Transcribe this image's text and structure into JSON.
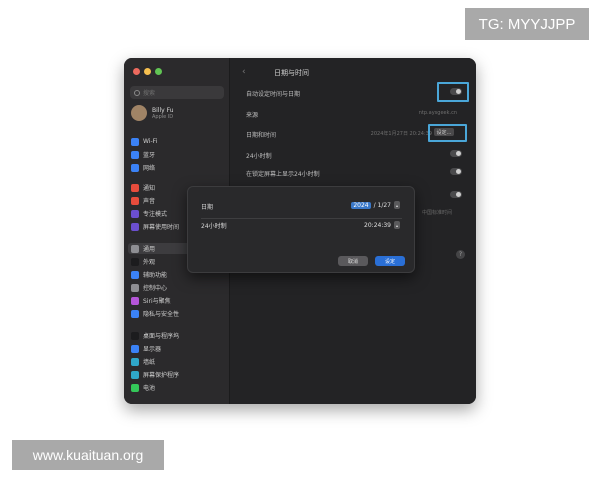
{
  "overlay": {
    "tg_label": "TG: MYYJJPP",
    "watermark": "www.kuaituan.org"
  },
  "window": {
    "title": "日期与时间",
    "search_placeholder": "搜索",
    "user": {
      "name": "Billy Fu",
      "subtitle": "Apple ID"
    },
    "sidebar": [
      {
        "label": "Wi-Fi",
        "icon": "wifi-icon",
        "color": "#3b82f6"
      },
      {
        "label": "蓝牙",
        "icon": "bluetooth-icon",
        "color": "#3b82f6"
      },
      {
        "label": "网络",
        "icon": "globe-icon",
        "color": "#3b82f6"
      },
      {
        "label": "通知",
        "icon": "bell-icon",
        "color": "#e74c3c"
      },
      {
        "label": "声音",
        "icon": "speaker-icon",
        "color": "#e74c3c"
      },
      {
        "label": "专注模式",
        "icon": "moon-icon",
        "color": "#6b4fcf"
      },
      {
        "label": "屏幕使用时间",
        "icon": "hourglass-icon",
        "color": "#6b4fcf"
      },
      {
        "label": "通用",
        "icon": "gear-icon",
        "color": "#8e8e93",
        "selected": true
      },
      {
        "label": "外观",
        "icon": "appearance-icon",
        "color": "#1c1c1e"
      },
      {
        "label": "辅助功能",
        "icon": "accessibility-icon",
        "color": "#3b82f6"
      },
      {
        "label": "控制中心",
        "icon": "control-center-icon",
        "color": "#8e8e93"
      },
      {
        "label": "Siri与聚焦",
        "icon": "siri-icon",
        "color": "#b455d8"
      },
      {
        "label": "隐私与安全性",
        "icon": "hand-icon",
        "color": "#3b82f6"
      },
      {
        "label": "桌面与程序坞",
        "icon": "dock-icon",
        "color": "#1c1c1e"
      },
      {
        "label": "显示器",
        "icon": "display-icon",
        "color": "#3b82f6"
      },
      {
        "label": "墙纸",
        "icon": "wallpaper-icon",
        "color": "#2fa7c9"
      },
      {
        "label": "屏幕保护程序",
        "icon": "screensaver-icon",
        "color": "#2fa7c9"
      },
      {
        "label": "电池",
        "icon": "battery-icon",
        "color": "#34c759"
      }
    ],
    "content": {
      "auto_set_label": "自动设定时间与日期",
      "source_label": "来源",
      "source_value": "ntp.aysgeek.cn",
      "datetime_label": "日期和时间",
      "datetime_value": "2024年1月27日 20:24:39",
      "set_button": "设定…",
      "hour24_label": "24小时制",
      "lockscreen_label": "在锁定屏幕上显示24小时制",
      "timezone_value": "中国标准时间"
    }
  },
  "dialog": {
    "date_label": "日期",
    "date_year": "2024",
    "date_rest": "/ 1/27",
    "time_label": "24小时制",
    "time_value": "20:24:39",
    "cancel": "取消",
    "ok": "设定"
  }
}
